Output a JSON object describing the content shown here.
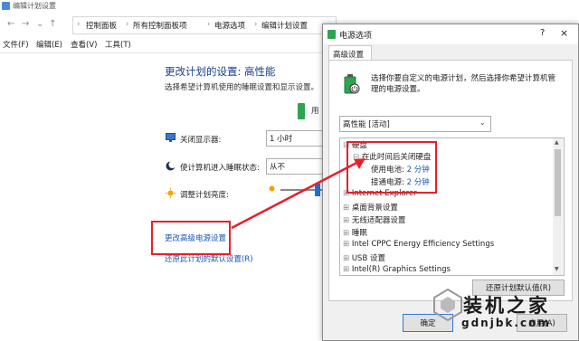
{
  "window": {
    "title": "编辑计划设置"
  },
  "address": {
    "crumbs": [
      "控制面板",
      "所有控制面板项",
      "电源选项",
      "编辑计划设置"
    ]
  },
  "menu": {
    "items": [
      "文件(F)",
      "编辑(E)",
      "查看(V)",
      "工具(T)"
    ]
  },
  "main": {
    "title": "更改计划的设置: 高性能",
    "subtitle": "选择希望计算机使用的睡眠设置和显示设置。",
    "plugged_label": "用",
    "rows": [
      {
        "label": "关闭显示器:",
        "value": "1 小时"
      },
      {
        "label": "使计算机进入睡眠状态:",
        "value": "从不"
      },
      {
        "label": "调整计划亮度:",
        "value": ""
      }
    ],
    "link_advanced": "更改高级电源设置",
    "link_restore": "还原此计划的默认设置(R)"
  },
  "dialog": {
    "title": "电源选项",
    "help": "?",
    "close": "×",
    "tab": "高级设置",
    "description": "选择你要自定义的电源计划，然后选择你希望计算机管理的电源设置。",
    "plan_select": "高性能 [活动]",
    "tree": [
      {
        "label": "硬盘",
        "expander": "⊟"
      },
      {
        "label": "在此时间后关闭硬盘",
        "expander": "⊟"
      },
      {
        "label": "使用电池:",
        "value": "2 分钟"
      },
      {
        "label": "接通电源:",
        "value": "2 分钟"
      },
      {
        "label": "Internet Explorer",
        "expander": "⊞"
      },
      {
        "label": "桌面背景设置",
        "expander": "⊞"
      },
      {
        "label": "无线适配器设置",
        "expander": "⊞"
      },
      {
        "label": "睡眠",
        "expander": "⊞"
      },
      {
        "label": "Intel CPPC Energy Efficiency Settings",
        "expander": "⊞"
      },
      {
        "label": "USB 设置",
        "expander": "⊞"
      },
      {
        "label": "Intel(R) Graphics Settings",
        "expander": "⊞"
      }
    ],
    "restore_button": "还原计划默认值(R)",
    "ok_button": "确定",
    "apply_button": "应用(A)"
  },
  "watermark": {
    "text": "装机之家",
    "url": "gdnjbk.com"
  },
  "colors": {
    "accent": "#3476d6",
    "highlight": "#e8202a",
    "link": "#1a56b8"
  }
}
